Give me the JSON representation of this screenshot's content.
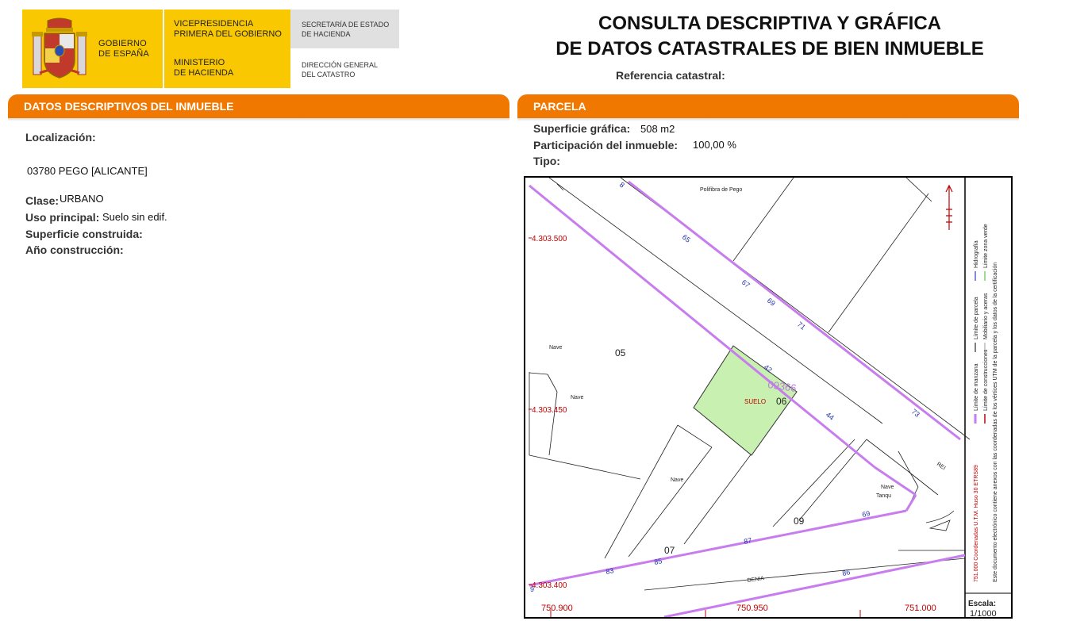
{
  "header": {
    "gobierno": [
      "GOBIERNO",
      "DE ESPAÑA"
    ],
    "vicepresidencia": [
      "VICEPRESIDENCIA",
      "PRIMERA DEL GOBIERNO"
    ],
    "ministerio": [
      "MINISTERIO",
      "DE HACIENDA"
    ],
    "secretaria": [
      "SECRETARÍA DE ESTADO",
      "DE HACIENDA"
    ],
    "direccion": [
      "DIRECCIÓN GENERAL",
      "DEL CATASTRO"
    ],
    "title_line1": "CONSULTA DESCRIPTIVA Y GRÁFICA",
    "title_line2": "DE DATOS CATASTRALES DE BIEN INMUEBLE",
    "ref_label": "Referencia catastral:"
  },
  "descriptivos": {
    "header": "DATOS DESCRIPTIVOS DEL INMUEBLE",
    "localizacion_label": "Localización:",
    "localizacion_value": "03780 PEGO [ALICANTE]",
    "clase_label": "Clase:",
    "clase_value": "URBANO",
    "uso_label": "Uso principal:",
    "uso_value": "Suelo sin edif.",
    "superficie_label": "Superficie construida:",
    "anio_label": "Año construcción:"
  },
  "parcela": {
    "header": "PARCELA",
    "superficie_label": "Superficie gráfica:",
    "superficie_value": "508 m2",
    "participacion_label": "Participación del inmueble:",
    "participacion_value": "100,00 %",
    "tipo_label": "Tipo:"
  },
  "map": {
    "street_top": "Polifibra de Pego",
    "street_right": "REI",
    "street_bottom": "DENIA",
    "y_labels": [
      "4.303.500",
      "4.303.450",
      "4.303.400"
    ],
    "x_labels": [
      "750.900",
      "750.950",
      "751.000"
    ],
    "block_numbers": [
      "05",
      "06",
      "07",
      "09"
    ],
    "parcel_ref": "09366",
    "parcel_label": "SUELO",
    "nave_labels": [
      "Nave",
      "Nave",
      "Nave",
      "Nave"
    ],
    "tanque_label": "Tanqu",
    "house_numbers": [
      "65",
      "67",
      "69",
      "71",
      "42",
      "44",
      "73",
      "69",
      "87",
      "85",
      "83",
      "86",
      "9",
      "8"
    ],
    "legend": [
      "Límite de manzana",
      "Límite de parcela",
      "Hidrografía",
      "Límite de construcciones",
      "Mobiliario y aceras",
      "Límite zona verde"
    ],
    "legend_coords": "751.000 Coordenadas U.T.M. Huso 30 ETRS89",
    "legend_note": "Este documento electrónico contiene anexos con las coordenadas de los vértices UTM de la parcela y los datos de la certificación",
    "scale_label": "Escala:",
    "scale_value": "1/1000",
    "colors": {
      "manzana": "#c77dee",
      "parcel_fill": "#c8f0b0",
      "coord_red": "#c00000",
      "number_blue": "#2233aa"
    }
  }
}
